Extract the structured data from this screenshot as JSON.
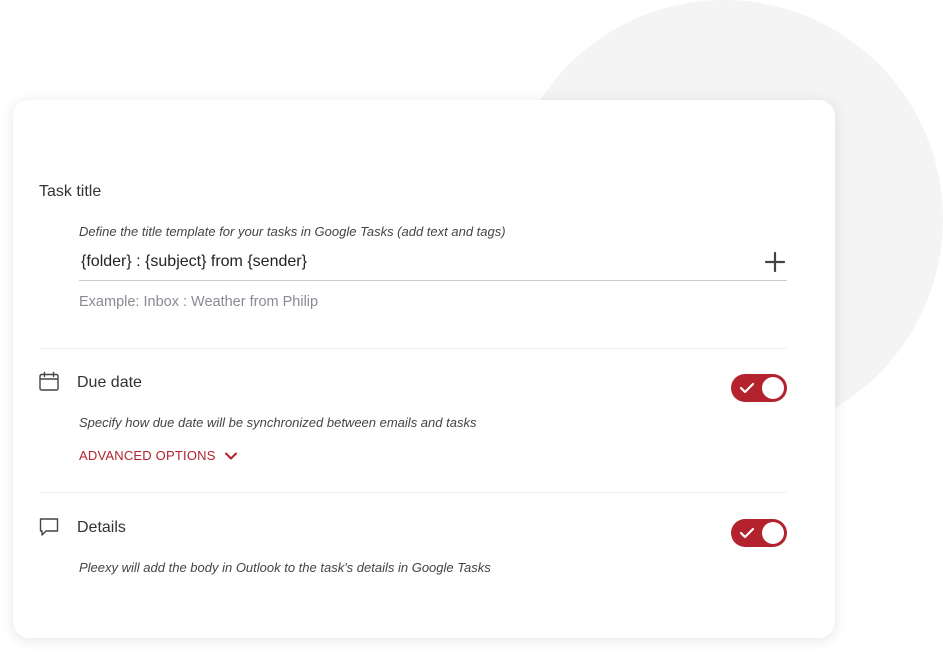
{
  "colors": {
    "accent": "#b3222d",
    "text_primary": "#333333",
    "text_muted": "#8a8a94",
    "background_circle": "#f4f4f4"
  },
  "task_title": {
    "heading": "Task title",
    "description": "Define the title template for your tasks in Google Tasks (add text and tags)",
    "template_value": "{folder} : {subject} from {sender}",
    "add_icon": "plus-icon",
    "example": "Example: Inbox : Weather from Philip"
  },
  "due_date": {
    "icon": "calendar-icon",
    "heading": "Due date",
    "enabled": true,
    "description": "Specify how due date will be synchronized between emails and tasks",
    "advanced_options_label": "ADVANCED OPTIONS",
    "advanced_options_icon": "chevron-down-icon"
  },
  "details": {
    "icon": "comment-icon",
    "heading": "Details",
    "enabled": true,
    "description": "Pleexy will add the body in Outlook to the task's details in Google Tasks"
  }
}
